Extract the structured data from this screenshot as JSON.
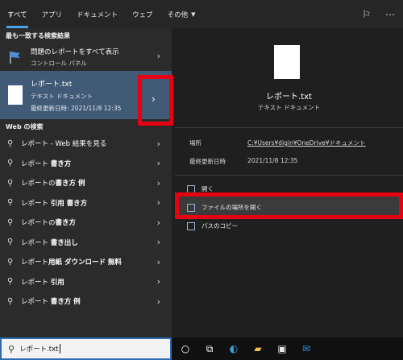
{
  "tabs": [
    {
      "label": "すべて"
    },
    {
      "label": "アプリ"
    },
    {
      "label": "ドキュメント"
    },
    {
      "label": "ウェブ"
    },
    {
      "label": "その他"
    }
  ],
  "left": {
    "best_header": "最も一致する検索結果",
    "best_item": {
      "title": "問題のレポートをすべて表示",
      "subtitle": "コントロール パネル"
    },
    "selected": {
      "title": "レポート.txt",
      "type": "テキスト ドキュメント",
      "modified": "最終更新日時: 2021/11/8 12:35"
    },
    "web_header": "Web の検索",
    "web_items": [
      {
        "prefix": "レポート",
        "bold": "",
        "suffix": " - Web 結果を見る"
      },
      {
        "prefix": "レポート ",
        "bold": "書き方",
        "suffix": ""
      },
      {
        "prefix": "レポートの",
        "bold": "書き方 例",
        "suffix": ""
      },
      {
        "prefix": "レポート ",
        "bold": "引用 書き方",
        "suffix": ""
      },
      {
        "prefix": "レポートの",
        "bold": "書き方",
        "suffix": ""
      },
      {
        "prefix": "レポート ",
        "bold": "書き出し",
        "suffix": ""
      },
      {
        "prefix": "レポート",
        "bold": "用紙 ダウンロード 無料",
        "suffix": ""
      },
      {
        "prefix": "レポート ",
        "bold": "引用",
        "suffix": ""
      },
      {
        "prefix": "レポート ",
        "bold": "書き方 例",
        "suffix": ""
      }
    ]
  },
  "right": {
    "file_name": "レポート.txt",
    "file_type": "テキスト ドキュメント",
    "location_label": "場所",
    "location_value": "C:¥Users¥digin¥OneDrive¥ドキュメント",
    "modified_label": "最終更新日時",
    "modified_value": "2021/11/8 12:35",
    "actions": [
      {
        "label": "開く"
      },
      {
        "label": "ファイルの場所を開く"
      },
      {
        "label": "パスのコピー"
      }
    ]
  },
  "taskbar": {
    "search_value": "レポート.txt"
  }
}
